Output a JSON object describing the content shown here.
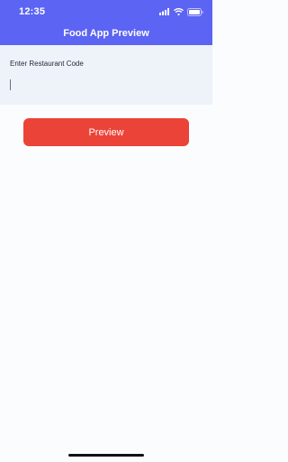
{
  "status_bar": {
    "time": "12:35",
    "icons": [
      "signal-icon",
      "wifi-icon",
      "battery-icon"
    ]
  },
  "header": {
    "title": "Food App Preview"
  },
  "form": {
    "label": "Enter Restaurant Code",
    "input_value": "",
    "input_placeholder": ""
  },
  "actions": {
    "preview_label": "Preview"
  },
  "colors": {
    "header_bg": "#5b64f3",
    "form_bg": "#eef3fa",
    "button_bg": "#ec4338",
    "page_bg": "#fbfcfe"
  }
}
